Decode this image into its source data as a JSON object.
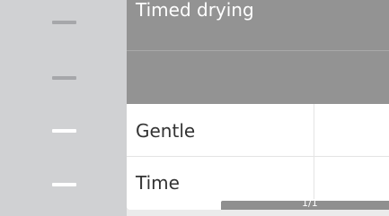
{
  "sidebar": {
    "indicators": [
      {
        "state": "inactive"
      },
      {
        "state": "inactive"
      },
      {
        "state": "active"
      },
      {
        "state": "active"
      }
    ]
  },
  "list": {
    "title": "Timed drying",
    "items": [
      {
        "label": "Gentle",
        "value": ""
      },
      {
        "label": "Time",
        "value": ""
      }
    ]
  },
  "pager": {
    "text": "1/1"
  },
  "colors": {
    "header_bg": "#939393",
    "sidebar_bg": "#d0d1d3",
    "row_bg": "#ffffff",
    "text_dark": "#333333"
  }
}
